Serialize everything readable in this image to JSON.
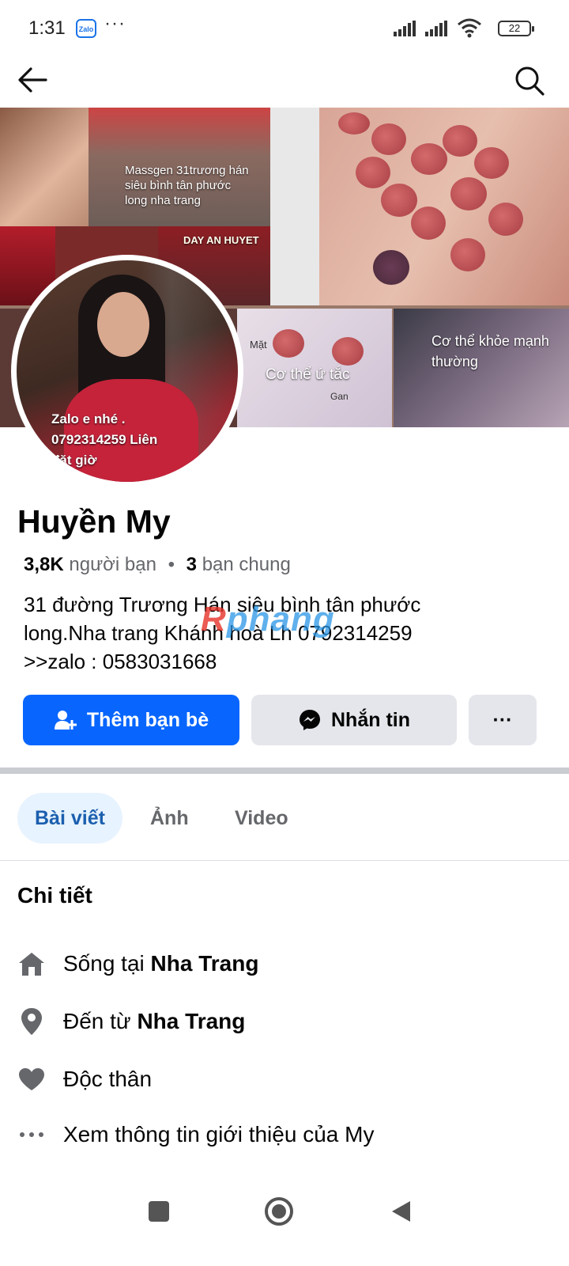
{
  "status_bar": {
    "time": "1:31",
    "zalo_label": "Zalo",
    "more": "···",
    "battery": "22"
  },
  "cover": {
    "caption_1": "Massgen 31trương hán\nsiêu bình tân phước\nlong nha trang",
    "caption_2": "Cơ thể ứ tắc",
    "caption_3": "Cơ thể khỏe mạnh\nthường",
    "caption_4": "DAY AN HUYET",
    "caption_5": "Mặt",
    "caption_6": "Gan"
  },
  "avatar": {
    "caption": "Zalo e nhé .\n0792314259 Liên\nđặt giờ"
  },
  "profile": {
    "name": "Huyền My",
    "friends_count": "3,8K",
    "friends_label": "người bạn",
    "mutual_count": "3",
    "mutual_label": "bạn chung",
    "bio": "31 đường Trương Hán siêu bình tân phước\nlong.Nha trang Khánh hoà Lh 0792314259\n>>zalo : 0583031668",
    "watermark_a": "R",
    "watermark_b": "phang"
  },
  "actions": {
    "add_friend": "Thêm bạn bè",
    "message": "Nhắn tin",
    "more": "···"
  },
  "tabs": [
    {
      "label": "Bài viết"
    },
    {
      "label": "Ảnh"
    },
    {
      "label": "Video"
    }
  ],
  "details": {
    "title": "Chi tiết",
    "lives_prefix": "Sống tại",
    "lives_place": "Nha Trang",
    "from_prefix": "Đến từ",
    "from_place": "Nha Trang",
    "relationship": "Độc thân",
    "see_about": "Xem thông tin giới thiệu của My"
  },
  "colors": {
    "primary": "#0866ff",
    "secondary_bg": "#e4e6eb",
    "tab_active_bg": "#e7f3ff",
    "muted_text": "#65676b"
  }
}
